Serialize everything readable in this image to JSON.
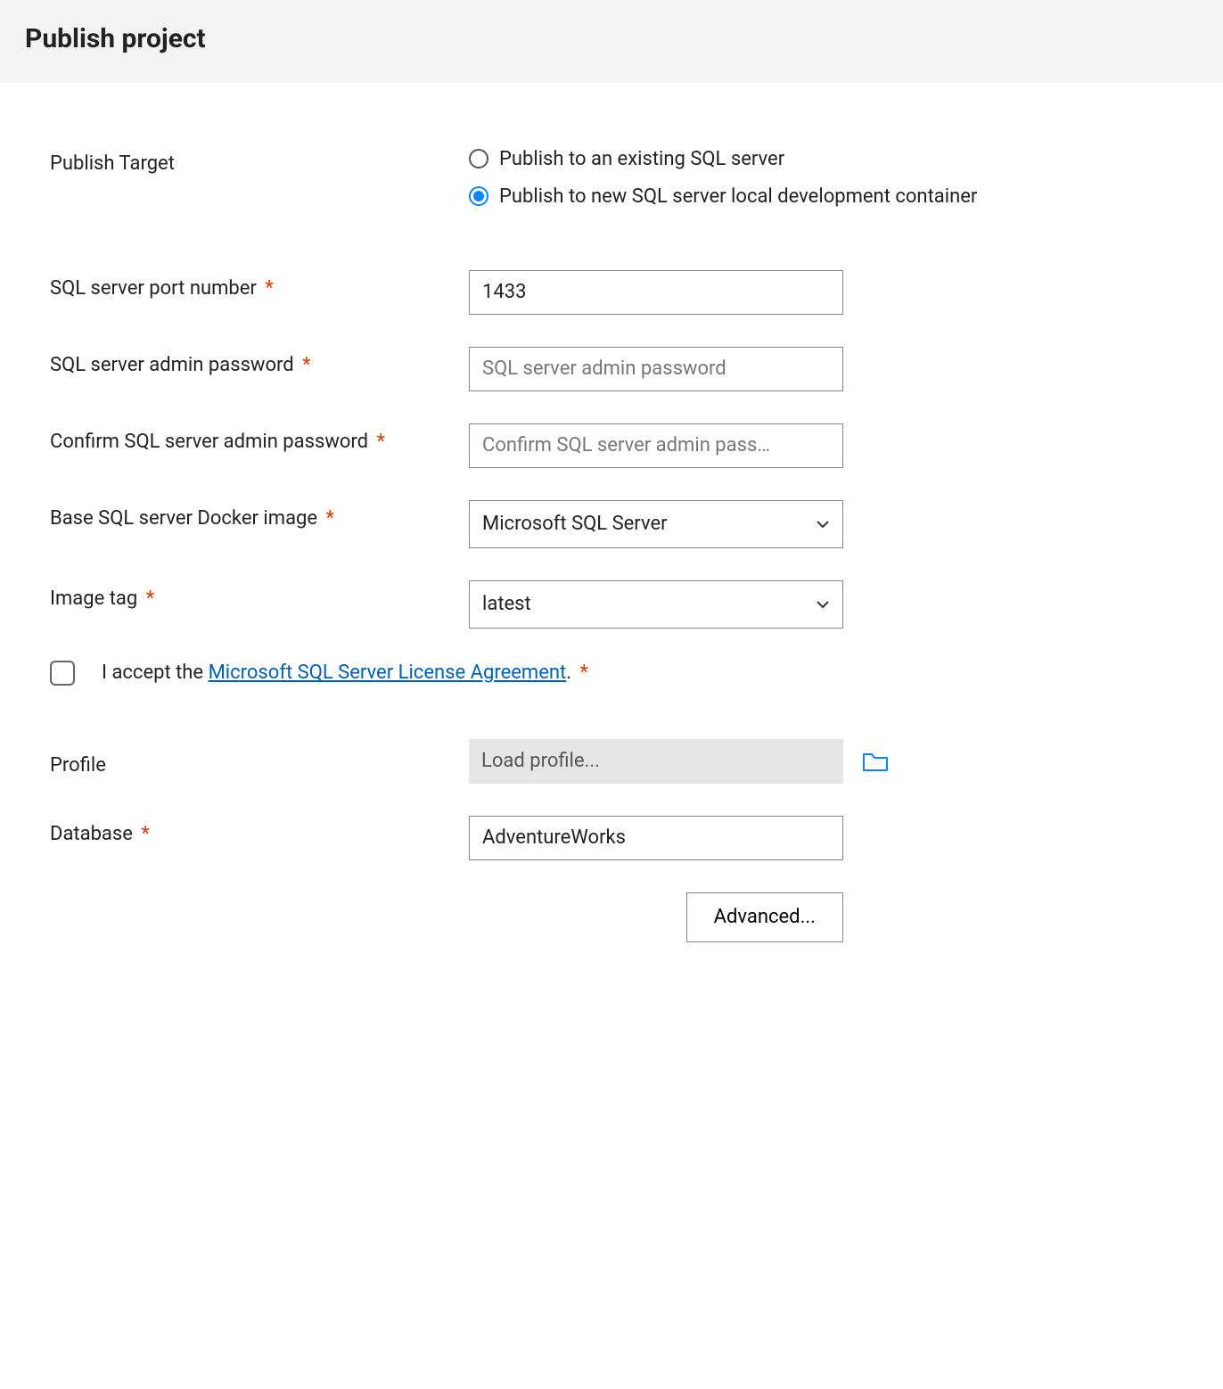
{
  "header": {
    "title": "Publish project"
  },
  "publishTarget": {
    "label": "Publish Target",
    "options": {
      "existing": "Publish to an existing SQL server",
      "newContainer": "Publish to new SQL server local development container"
    },
    "selected": "newContainer"
  },
  "fields": {
    "port": {
      "label": "SQL server port number",
      "value": "1433",
      "required": true
    },
    "adminPassword": {
      "label": "SQL server admin password",
      "placeholder": "SQL server admin password",
      "value": "",
      "required": true
    },
    "confirmPassword": {
      "label": "Confirm SQL server admin password",
      "placeholder": "Confirm SQL server admin pass…",
      "value": "",
      "required": true
    },
    "dockerImage": {
      "label": "Base SQL server Docker image",
      "value": "Microsoft SQL Server",
      "required": true
    },
    "imageTag": {
      "label": "Image tag",
      "value": "latest",
      "required": true
    },
    "license": {
      "prefix": "I accept the ",
      "linkText": "Microsoft SQL Server License Agreement",
      "suffix": ".",
      "checked": false,
      "required": true
    },
    "profile": {
      "label": "Profile",
      "placeholder": "Load profile..."
    },
    "database": {
      "label": "Database",
      "value": "AdventureWorks",
      "required": true
    }
  },
  "buttons": {
    "advanced": "Advanced..."
  },
  "requiredMark": "*"
}
